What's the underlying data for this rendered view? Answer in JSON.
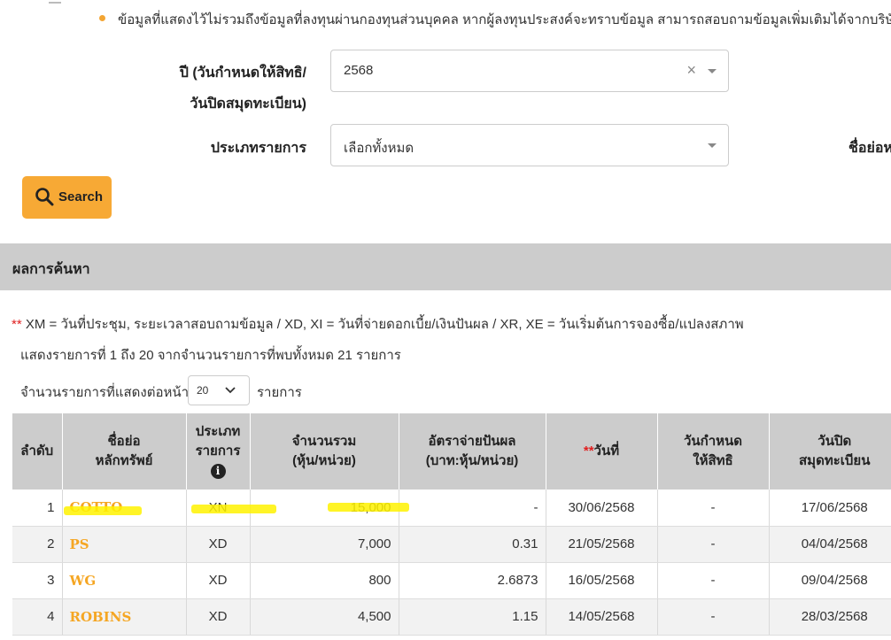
{
  "note": {
    "text": "ข้อมูลที่แสดงไว้ไม่รวมถึงข้อมูลที่ลงทุนผ่านกองทุนส่วนบุคคล หากผู้ลงทุนประสงค์จะทราบข้อมูล สามารถสอบถามข้อมูลเพิ่มเติมได้จากบริษัทจัดก"
  },
  "form": {
    "year_label_line1": "ปี (วันกำหนดให้สิทธิ/",
    "year_label_line2": "วันปิดสมุดทะเบียน)",
    "year_value": "2568",
    "clear_symbol": "×",
    "type_label": "ประเภทรายการ",
    "type_value": "เลือกทั้งหมด",
    "symbol_label": "ชื่อย่อห",
    "search_label": "Search"
  },
  "results": {
    "title": "ผลการค้นหา",
    "legend_stars": "**",
    "legend_text": " XM = วันที่ประชุม, ระยะเวลาสอบถามข้อมูล / XD, XI = วันที่จ่ายดอกเบี้ย/เงินปันผล / XR, XE = วันเริ่มต้นการจองซื้อ/แปลงสภาพ",
    "count_text": "แสดงรายการที่ 1 ถึง 20 จากจำนวนรายการที่พบทั้งหมด 21 รายการ",
    "per_page_label": "จำนวนรายการที่แสดงต่อหน้า",
    "per_page_value": "20",
    "per_page_unit": "รายการ"
  },
  "table": {
    "headers": {
      "no": "ลำดับ",
      "symbol_1": "ชื่อย่อ",
      "symbol_2": "หลักทรัพย์",
      "type_1": "ประเภท",
      "type_2": "รายการ",
      "type_info": "i",
      "volume_1": "จำนวนรวม",
      "volume_2": "(หุ้น/หน่วย)",
      "rate_1": "อัตราจ่ายปันผล",
      "rate_2": "(บาท:หุ้น/หน่วย)",
      "date_stars": "**",
      "date": "วันที่",
      "record_1": "วันกำหนด",
      "record_2": "ให้สิทธิ",
      "book_1": "วันปิด",
      "book_2": "สมุดทะเบียน"
    },
    "rows": [
      {
        "no": "1",
        "symbol": "COTTO",
        "type": "XN",
        "volume": "15,000",
        "rate": "-",
        "date": "30/06/2568",
        "record": "-",
        "book": "17/06/2568"
      },
      {
        "no": "2",
        "symbol": "PS",
        "type": "XD",
        "volume": "7,000",
        "rate": "0.31",
        "date": "21/05/2568",
        "record": "-",
        "book": "04/04/2568"
      },
      {
        "no": "3",
        "symbol": "WG",
        "type": "XD",
        "volume": "800",
        "rate": "2.6873",
        "date": "16/05/2568",
        "record": "-",
        "book": "09/04/2568"
      },
      {
        "no": "4",
        "symbol": "ROBINS",
        "type": "XD",
        "volume": "4,500",
        "rate": "1.15",
        "date": "14/05/2568",
        "record": "-",
        "book": "28/03/2568"
      }
    ]
  },
  "colors": {
    "accent": "#f7a935",
    "symbol": "#f5a623",
    "header_bg": "#cccccc",
    "highlight": "#fff200"
  }
}
